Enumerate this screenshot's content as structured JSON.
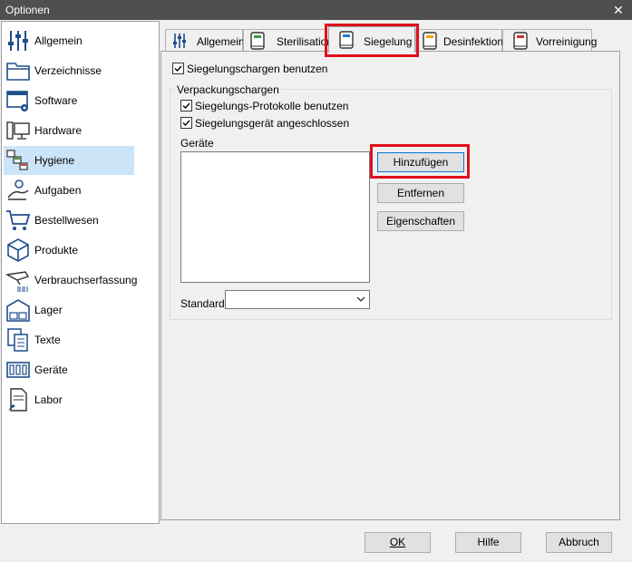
{
  "window": {
    "title": "Optionen"
  },
  "sidebar": {
    "items": [
      {
        "label": "Allgemein",
        "icon": "sliders-icon"
      },
      {
        "label": "Verzeichnisse",
        "icon": "folder-icon"
      },
      {
        "label": "Software",
        "icon": "software-icon"
      },
      {
        "label": "Hardware",
        "icon": "computer-icon"
      },
      {
        "label": "Hygiene",
        "icon": "hygiene-icon",
        "selected": true
      },
      {
        "label": "Aufgaben",
        "icon": "task-person-icon"
      },
      {
        "label": "Bestellwesen",
        "icon": "shopping-cart-icon"
      },
      {
        "label": "Produkte",
        "icon": "box-icon"
      },
      {
        "label": "Verbrauchserfassung",
        "icon": "barcode-scanner-icon"
      },
      {
        "label": "Lager",
        "icon": "warehouse-icon"
      },
      {
        "label": "Texte",
        "icon": "documents-icon"
      },
      {
        "label": "Geräte",
        "icon": "devices-icon"
      },
      {
        "label": "Labor",
        "icon": "lab-report-icon"
      }
    ]
  },
  "tabs": [
    {
      "label": "Allgemein",
      "icon": "sliders-icon"
    },
    {
      "label": "Sterilisation",
      "icon": "book-green-icon"
    },
    {
      "label": "Siegelung",
      "icon": "book-blue-icon",
      "active": true
    },
    {
      "label": "Desinfektion",
      "icon": "book-orange-icon"
    },
    {
      "label": "Vorreinigung",
      "icon": "book-red-icon"
    }
  ],
  "siegelung": {
    "use_batches_label": "Siegelungschargen benutzen",
    "use_batches_checked": true,
    "group_title": "Verpackungschargen",
    "protocols_label": "Siegelungs-Protokolle benutzen",
    "protocols_checked": true,
    "device_connected_label": "Siegelungsgerät angeschlossen",
    "device_connected_checked": true,
    "devices_label": "Geräte",
    "add_button": "Hinzufügen",
    "remove_button": "Entfernen",
    "properties_button": "Eigenschaften",
    "standard_label": "Standard",
    "standard_value": ""
  },
  "footer": {
    "ok_button": "OK",
    "help_button": "Hilfe",
    "cancel_button": "Abbruch"
  },
  "colors": {
    "highlight": "#e0101c",
    "selection": "#cce4f7",
    "titlebar": "#4f4f4f"
  }
}
